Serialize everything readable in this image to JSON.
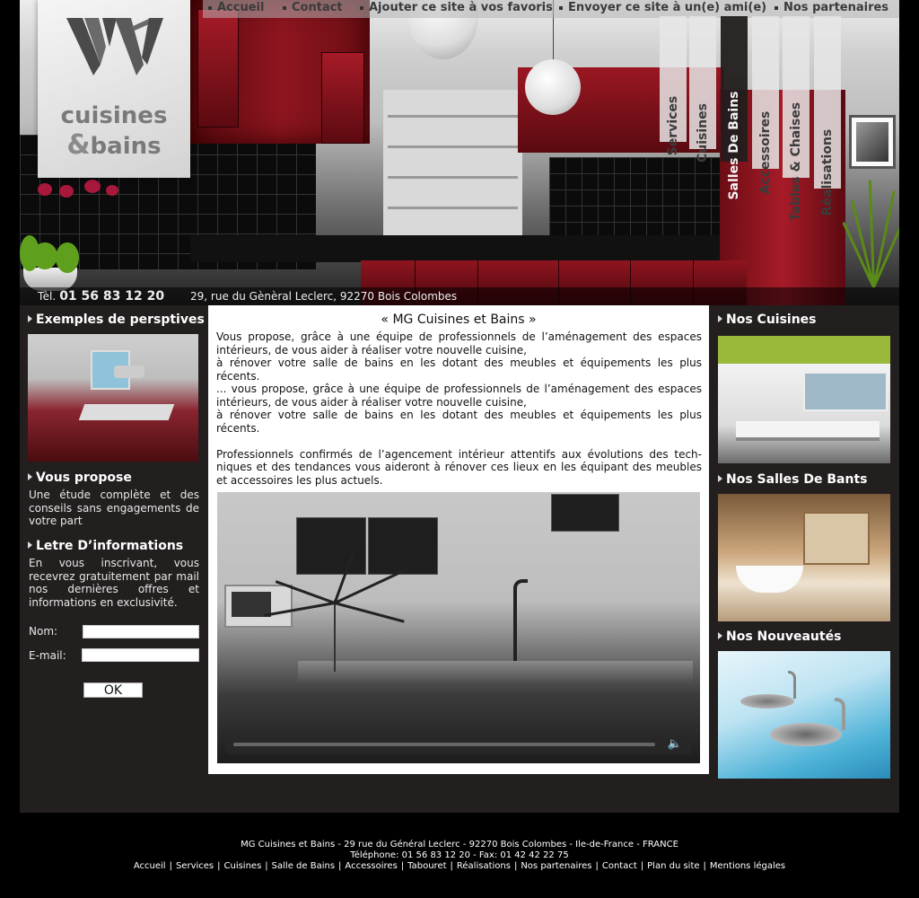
{
  "logo": {
    "line1": "cuisines",
    "line2_amp": "&",
    "line2": "bains"
  },
  "topnav": [
    "Accueil",
    "Contact",
    "Ajouter ce site à vos favoris",
    "Envoyer ce site à un(e) ami(e)",
    "Nos partenaires"
  ],
  "vtabs": [
    "Services",
    "Cuisines",
    "Salles De Bains",
    "Accessoires",
    "Tables & Chaises",
    "Réalisations"
  ],
  "vtabs_active": "Salles De Bains",
  "contact": {
    "tel_label": "Tèl.",
    "tel": "01 56 83 12 20",
    "address": "29, rue du Gènèral Leclerc, 92270 Bois Colombes"
  },
  "left": {
    "exemples_title": "Exemples de persptives",
    "propose_title": "Vous propose",
    "propose_text": "Une étude complète et des conseils sans engagements de votre part",
    "letre_title": "Letre D’informations",
    "letre_text": "En vous inscrivant, vous recevrez gratuitement par mail nos dernières offres et informations en exclusivité.",
    "nom_label": "Nom:",
    "email_label": "E-mail:",
    "ok_label": "OK"
  },
  "center": {
    "title": "« MG Cuisines et Bains »",
    "paragraphs": [
      "Vous propose, grâce à une équipe de professionnels de l’aménagement des espaces intérieurs, de vous aider à réaliser votre nouvelle cuisine,",
      "à rénover votre salle de bains en les dotant des meubles et équipements les plus récents.",
      "... vous propose, grâce à une équipe de professionnels de l’aménagement des espaces intérieurs, de vous aider à réaliser votre nouvelle cuisine,",
      "à rénover votre salle de bains en les dotant des meubles et équipements les plus récents.",
      "Professionnels confirmés de l’agencement intérieur attentifs aux évolutions des tech-niques et des tendances vous aideront à rénover ces lieux en les équipant des meubles et accessoires les plus actuels."
    ]
  },
  "right": {
    "cuisines_title": "Nos Cuisines",
    "sdb_title": "Nos Salles De Bants",
    "nouv_title": "Nos Nouveautés"
  },
  "footer": {
    "line1": "MG Cuisines et Bains - 29 rue du Général Leclerc - 92270 Bois Colombes - Ile-de-France - FRANCE",
    "line2": "Téléphone: 01 56 83 12 20 - Fax: 01 42 42 22 75",
    "links": [
      "Accueil",
      "Services",
      "Cuisines",
      "Salle de Bains",
      "Accessoires",
      "Tabouret",
      "Réalisations",
      "Nos partenaires",
      "Contact",
      "Plan du site",
      "Mentions légales"
    ]
  },
  "icons": {
    "bullet": "triangle-right-icon",
    "volume": "speaker-icon"
  }
}
